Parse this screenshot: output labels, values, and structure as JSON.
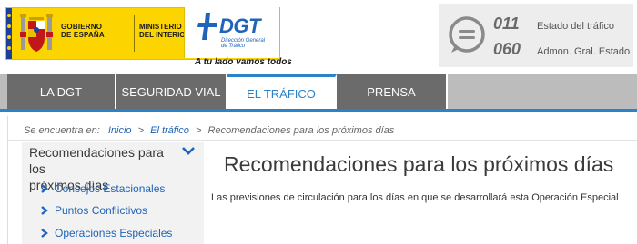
{
  "header": {
    "gov_line1": "GOBIERNO",
    "gov_line2": "DE ESPAÑA",
    "ministry_line1": "MINISTERIO",
    "ministry_line2": "DEL INTERIOR",
    "dgt_wordmark": "DGT",
    "dgt_sub1": "Dirección General",
    "dgt_sub2": "de Tráfico",
    "tagline": "A tu lado vamos todos",
    "brand_yellow": "#fcd400",
    "brand_blue": "#1f64b8"
  },
  "contact": {
    "icon": "chat-bubble-icon",
    "rows": [
      {
        "number": "011",
        "label": "Estado del tráfico"
      },
      {
        "number": "060",
        "label": "Admon. Gral. Estado"
      }
    ]
  },
  "nav": {
    "tabs": [
      {
        "label": "LA DGT"
      },
      {
        "label": "SEGURIDAD VIAL"
      },
      {
        "label": "EL TRÁFICO"
      },
      {
        "label": "PRENSA"
      }
    ],
    "active_tab": "EL TRÁFICO",
    "accent": "#2a82c9"
  },
  "breadcrumb": {
    "prefix": "Se encuentra en:",
    "links": [
      "Inicio",
      "El tráfico"
    ],
    "current": "Recomendaciones para los próximos días"
  },
  "sidebar": {
    "heading_line1": "Recomendaciones para los",
    "heading_line2": "próximos días",
    "items": [
      {
        "label": "Consejos Estacionales"
      },
      {
        "label": "Puntos Conflictivos"
      },
      {
        "label": "Operaciones Especiales"
      }
    ]
  },
  "main": {
    "title": "Recomendaciones para los próximos días",
    "body": "Las previsiones de circulación para los días en que se desarrollará esta Operación Especial"
  }
}
